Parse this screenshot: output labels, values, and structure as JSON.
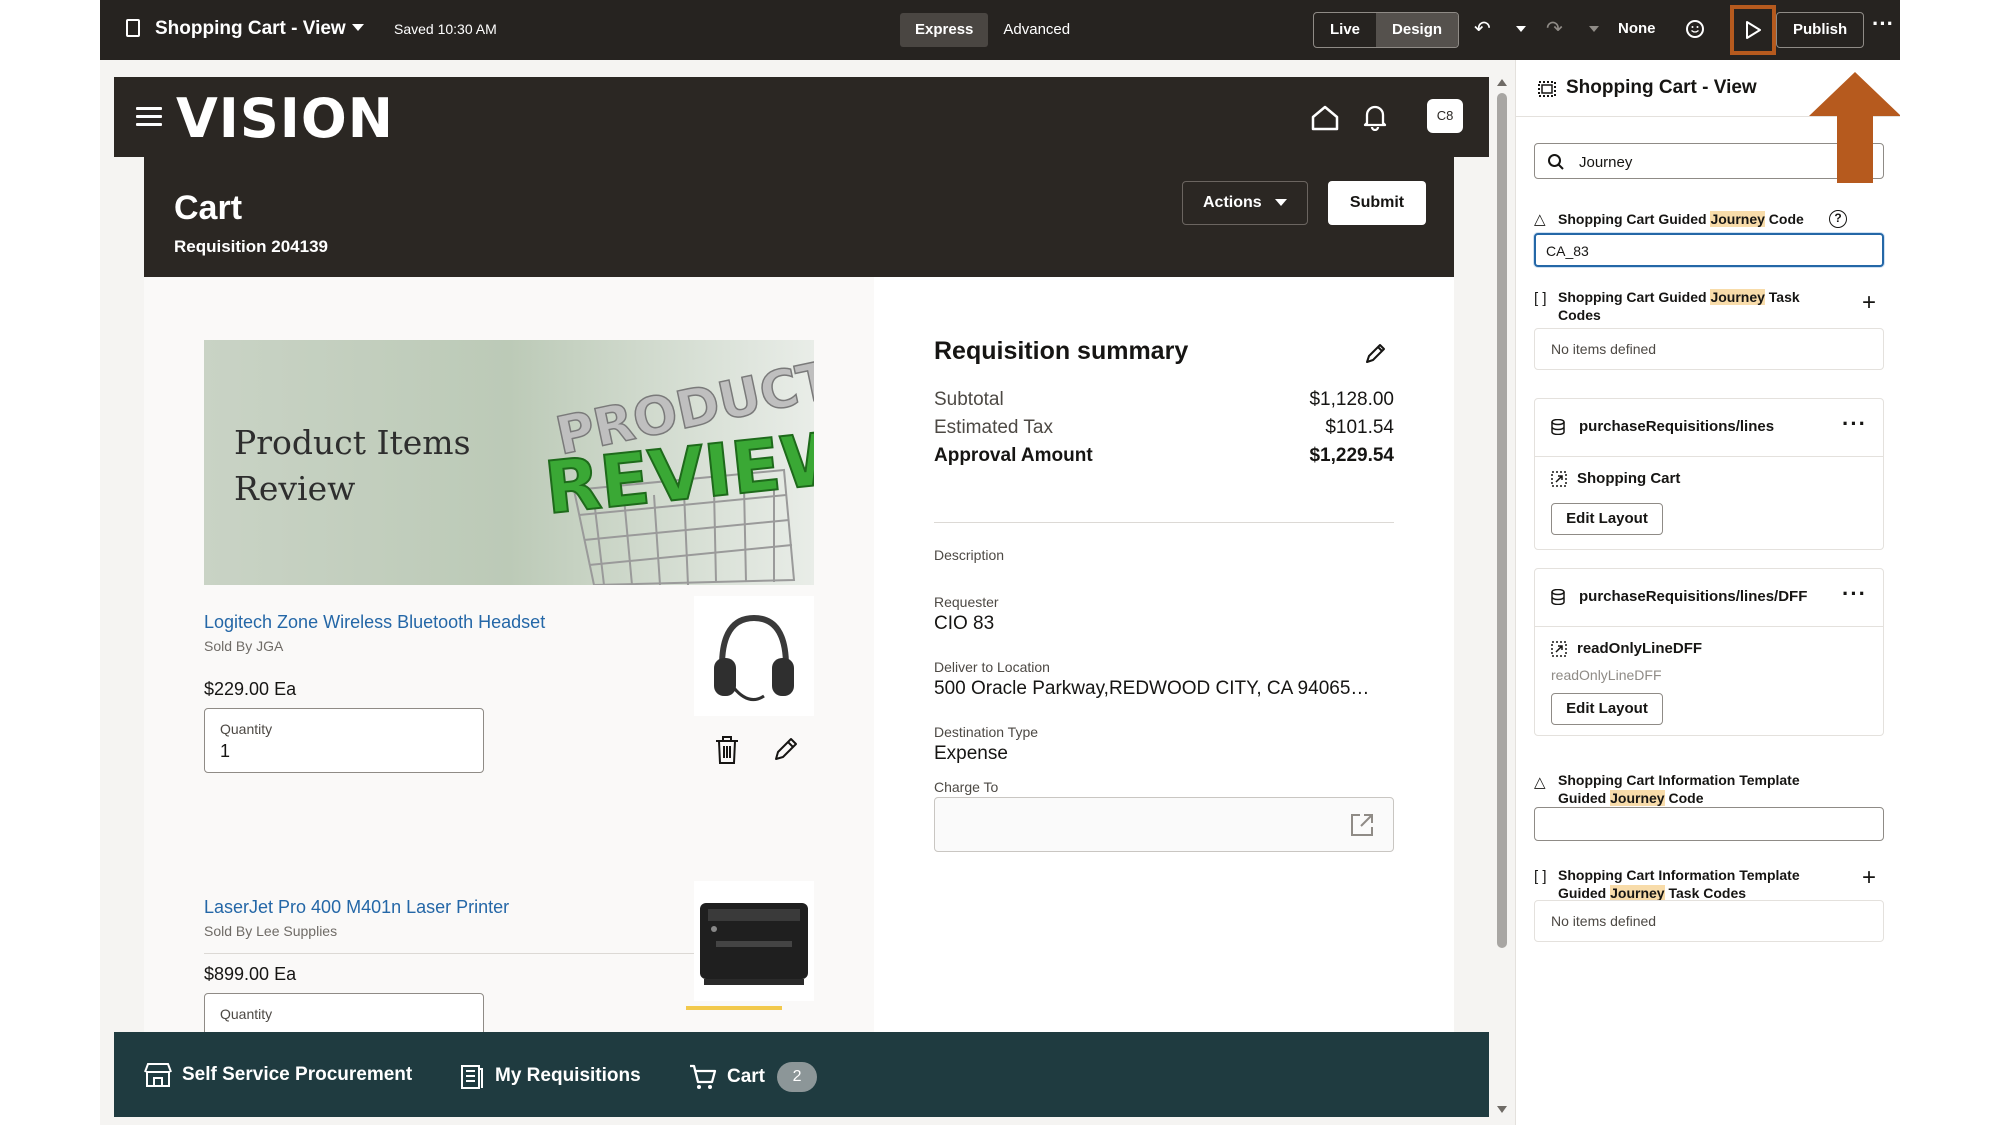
{
  "topbar": {
    "page_title": "Shopping Cart - View",
    "saved": "Saved 10:30 AM",
    "mode_tabs": [
      "Express",
      "Advanced"
    ],
    "active_mode": "Express",
    "view_tabs": [
      "Live",
      "Design"
    ],
    "active_view": "Design",
    "sandbox": "None",
    "publish": "Publish",
    "highlight_color": "#b65a1e"
  },
  "header": {
    "logo": "VISION",
    "avatar": "C8"
  },
  "cart": {
    "title": "Cart",
    "requisition": "Requisition 204139",
    "actions": "Actions",
    "submit": "Submit"
  },
  "banner": {
    "text": "Product Items Review"
  },
  "products": [
    {
      "name": "Logitech Zone Wireless Bluetooth Headset",
      "seller": "Sold By JGA",
      "price": "$229.00 Ea",
      "quantity_label": "Quantity",
      "quantity": "1"
    },
    {
      "name": "LaserJet Pro 400 M401n Laser Printer",
      "seller": "Sold By Lee Supplies",
      "price": "$899.00 Ea",
      "quantity_label": "Quantity",
      "quantity": ""
    }
  ],
  "summary": {
    "title": "Requisition summary",
    "subtotal_label": "Subtotal",
    "subtotal": "$1,128.00",
    "tax_label": "Estimated Tax",
    "tax": "$101.54",
    "approval_label": "Approval Amount",
    "approval": "$1,229.54",
    "description_label": "Description",
    "requester_label": "Requester",
    "requester": "CIO 83",
    "deliver_label": "Deliver to Location",
    "deliver": "500 Oracle Parkway,REDWOOD CITY, CA 94065…",
    "dest_type_label": "Destination Type",
    "dest_type": "Expense",
    "charge_label": "Charge To"
  },
  "footer": {
    "self_service": "Self Service Procurement",
    "my_requisitions": "My Requisitions",
    "cart": "Cart",
    "cart_count": "2"
  },
  "panel": {
    "title": "Shopping Cart - View",
    "search_value": "Journey",
    "fields": {
      "gj_code_pre": "Shopping Cart Guided ",
      "gj_code_hl": "Journey",
      "gj_code_post": " Code",
      "gj_code_value": "CA_83",
      "gj_task_pre": "Shopping Cart Guided ",
      "gj_task_hl": "Journey",
      "gj_task_post": " Task Codes",
      "no_items": "No items defined",
      "info_code_pre": "Shopping Cart Information Template Guided ",
      "info_code_hl": "Journey",
      "info_code_post": " Code",
      "info_task_pre": "Shopping Cart Information Template Guided ",
      "info_task_hl": "Journey",
      "info_task_post": " Task Codes",
      "no_items_2": "No items defined"
    },
    "card1": {
      "name": "purchaseRequisitions/lines",
      "sub": "Shopping Cart",
      "button": "Edit Layout"
    },
    "card2": {
      "name": "purchaseRequisitions/lines/DFF",
      "sub": "readOnlyLineDFF",
      "subtext": "readOnlyLineDFF",
      "button": "Edit Layout"
    }
  }
}
